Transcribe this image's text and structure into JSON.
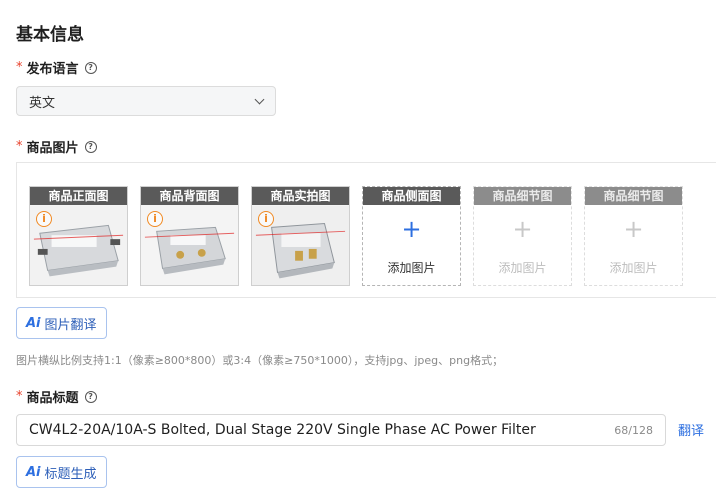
{
  "section_title": "基本信息",
  "language": {
    "label": "发布语言",
    "selected": "英文"
  },
  "images": {
    "label": "商品图片",
    "slots": [
      {
        "caption": "商品正面图",
        "state": "filled"
      },
      {
        "caption": "商品背面图",
        "state": "filled"
      },
      {
        "caption": "商品实拍图",
        "state": "filled"
      },
      {
        "caption": "商品侧面图",
        "state": "empty",
        "add_label": "添加图片"
      },
      {
        "caption": "商品细节图",
        "state": "disabled",
        "add_label": "添加图片"
      },
      {
        "caption": "商品细节图",
        "state": "disabled",
        "add_label": "添加图片"
      }
    ],
    "translate_button": "图片翻译",
    "hint": "图片横纵比例支持1:1（像素≥800*800）或3:4（像素≥750*1000），支持jpg、jpeg、png格式；"
  },
  "title_field": {
    "label": "商品标题",
    "value": "CW4L2-20A/10A-S Bolted, Dual Stage 220V Single Phase AC Power Filter",
    "counter": "68/128",
    "translate_link": "翻译",
    "generate_button": "标题生成"
  },
  "icons": {
    "help": "question-circle-icon",
    "dropdown": "chevron-down-icon",
    "add": "plus-icon",
    "warning": "info-circle-icon",
    "ai": "ai-icon"
  },
  "colors": {
    "accent": "#2d6fe0",
    "required": "#e8412c",
    "caption_bg": "#5a5a5a",
    "warning": "#f08a24"
  }
}
